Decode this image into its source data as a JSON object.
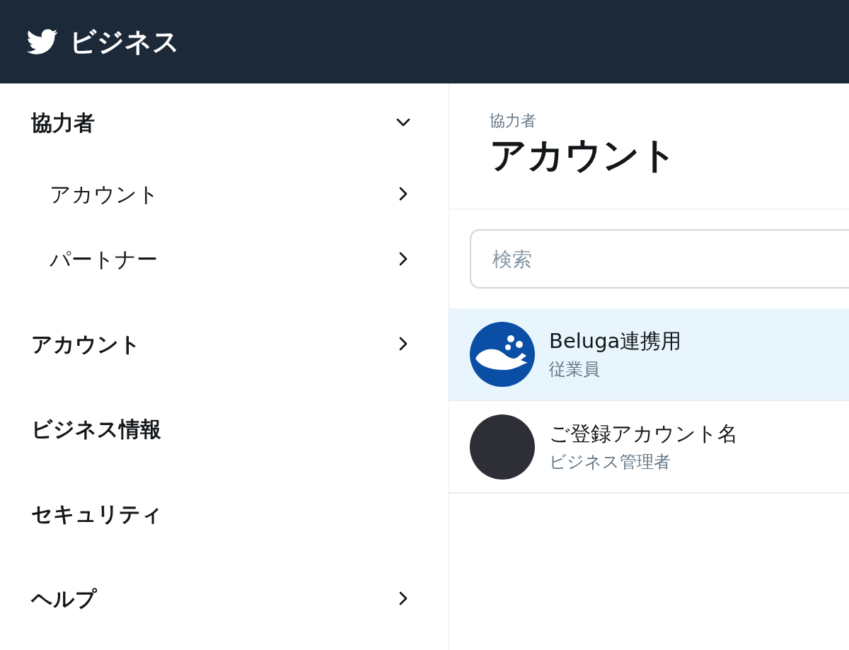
{
  "header": {
    "brand": "ビジネス"
  },
  "sidebar": {
    "items": [
      {
        "kind": "group",
        "label": "協力者",
        "expanded": true,
        "children": [
          {
            "label": "アカウント"
          },
          {
            "label": "パートナー"
          }
        ]
      },
      {
        "kind": "link",
        "label": "アカウント"
      },
      {
        "kind": "plain",
        "label": "ビジネス情報"
      },
      {
        "kind": "plain",
        "label": "セキュリティ"
      },
      {
        "kind": "link",
        "label": "ヘルプ"
      }
    ]
  },
  "main": {
    "breadcrumb": "協力者",
    "title": "アカウント",
    "search": {
      "placeholder": "検索"
    },
    "accounts": [
      {
        "kind": "logo",
        "name": "Beluga連携用",
        "role": "従業員",
        "selected": true
      },
      {
        "kind": "photo",
        "name": "ご登録アカウント名",
        "role": "ビジネス管理者",
        "selected": false
      }
    ]
  }
}
